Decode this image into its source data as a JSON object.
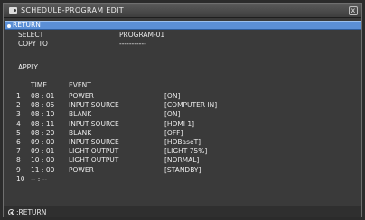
{
  "window": {
    "title": "SCHEDULE-PROGRAM EDIT",
    "close_glyph": "x"
  },
  "menu": {
    "return_label": "RETURN",
    "select_label": "SELECT",
    "select_value": "PROGRAM-01",
    "copy_label": "COPY TO",
    "copy_value": "-----------",
    "apply_label": "APPLY"
  },
  "table": {
    "col_time": "TIME",
    "col_event": "EVENT",
    "rows": [
      {
        "num": "1",
        "time": "08 : 01",
        "event": "POWER",
        "param": "[ON]"
      },
      {
        "num": "2",
        "time": "08 : 05",
        "event": "INPUT SOURCE",
        "param": "[COMPUTER IN]"
      },
      {
        "num": "3",
        "time": "08 : 10",
        "event": "BLANK",
        "param": "[ON]"
      },
      {
        "num": "4",
        "time": "08 : 11",
        "event": "INPUT SOURCE",
        "param": "[HDMI 1]"
      },
      {
        "num": "5",
        "time": "08 : 20",
        "event": "BLANK",
        "param": "[OFF]"
      },
      {
        "num": "6",
        "time": "09 : 00",
        "event": "INPUT SOURCE",
        "param": "[HDBaseT]"
      },
      {
        "num": "7",
        "time": "09 : 01",
        "event": "LIGHT OUTPUT",
        "param": "[LIGHT 75%]"
      },
      {
        "num": "8",
        "time": "10 : 00",
        "event": "LIGHT OUTPUT",
        "param": "[NORMAL]"
      },
      {
        "num": "9",
        "time": "11 : 00",
        "event": "POWER",
        "param": "[STANDBY]"
      },
      {
        "num": "10",
        "time": "-- : --",
        "event": "",
        "param": ""
      }
    ]
  },
  "footer": {
    "return_label": ":RETURN"
  },
  "colors": {
    "highlight": "#5b8fd6",
    "background": "#3a3a3a",
    "text": "#eaeaea"
  }
}
